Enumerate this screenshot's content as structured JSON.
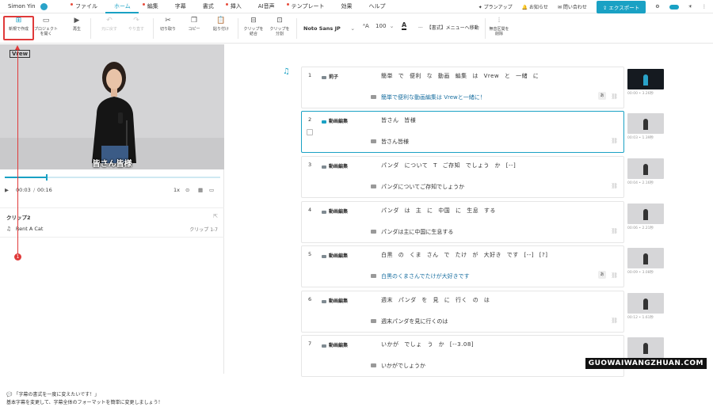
{
  "user": {
    "name": "Simon Yin"
  },
  "menu": [
    {
      "label": "ファイル",
      "dot": true
    },
    {
      "label": "ホーム",
      "dot": false,
      "active": true
    },
    {
      "label": "編集",
      "dot": true
    },
    {
      "label": "字幕",
      "dot": false
    },
    {
      "label": "書式",
      "dot": false
    },
    {
      "label": "挿入",
      "dot": true
    },
    {
      "label": "AI音声",
      "dot": false
    },
    {
      "label": "テンプレート",
      "dot": true
    },
    {
      "label": "効果",
      "dot": false
    },
    {
      "label": "ヘルプ",
      "dot": false
    }
  ],
  "top_right": {
    "plan": "プランアップ",
    "notice": "お知らせ",
    "contact": "問い合わせ",
    "export": "エクスポート"
  },
  "toolbar": {
    "new_project": "新規で作成",
    "open_project": [
      "プロジェクト",
      "を開く"
    ],
    "play": "再生",
    "undo": "元に戻す",
    "redo": "やり直す",
    "cut": "切り取り",
    "copy": "コピー",
    "paste": "貼り付け",
    "merge": [
      "クリップを",
      "結合"
    ],
    "split": [
      "クリップを",
      "分割"
    ],
    "font": "Noto Sans JP",
    "font_size": "100",
    "format_hint": "【書式】メニューへ移動",
    "silence": [
      "無音区間を",
      "削除"
    ]
  },
  "preview": {
    "logo": "Vrew",
    "subtitle": "皆さん皆様"
  },
  "player": {
    "current": "00:03",
    "total": "00:16",
    "speed": "1x"
  },
  "clip_panel": {
    "title": "クリップ2",
    "music": "Rent A Cat",
    "count": "クリップ 1-7"
  },
  "annotation": {
    "badge": "1"
  },
  "tip": {
    "title": "「字幕の書式を一度に変えたいです！」",
    "body": "基本字幕を変更して、字幕全体のフォーマットを簡単に変更しましょう！"
  },
  "clips": [
    {
      "num": "1",
      "speaker": "莉子",
      "words": "簡単 で 便利 な 動画 編集 は Vrew と 一緒 に",
      "subtitle": "簡単で便利な動画編集は Vrewと一緒に！",
      "blue": true,
      "aa": "あ",
      "thumb_label": "00:00 • 3.26秒",
      "dark": true
    },
    {
      "num": "2",
      "speaker": "動画編集",
      "words": "皆さん 皆様",
      "subtitle": "皆さん皆様",
      "blue": false,
      "aa": "",
      "thumb_label": "00:03 • 1.39秒",
      "dark": false,
      "selected": true
    },
    {
      "num": "3",
      "speaker": "動画編集",
      "words": "パンダ について T ご存知 でしょう か [--]",
      "subtitle": "パンダについてご存知でしょうか",
      "blue": false,
      "aa": "",
      "thumb_label": "00:04 • 2.16秒",
      "dark": false
    },
    {
      "num": "4",
      "speaker": "動画編集",
      "words": "パンダ は 主 に 中国 に 生息 する",
      "subtitle": "パンダは主に中国に生息する",
      "blue": false,
      "aa": "",
      "thumb_label": "00:06 • 2.21秒",
      "dark": false
    },
    {
      "num": "5",
      "speaker": "動画編集",
      "words": "白黒 の くま さん で たけ が 大好き です [--] [?]",
      "subtitle": "白黒のくまさんでたけが大好きです",
      "blue": true,
      "aa": "あ",
      "thumb_label": "00:09 • 3.08秒",
      "dark": false
    },
    {
      "num": "6",
      "speaker": "動画編集",
      "words": "週末 パンダ を 見 に 行く の は",
      "subtitle": "週末パンダを見に行くのは",
      "blue": false,
      "aa": "",
      "thumb_label": "00:12 • 1.61秒",
      "dark": false
    },
    {
      "num": "7",
      "speaker": "動画編集",
      "words": "いかが でしょ う か [--3.08]",
      "subtitle": "いかがでしょうか",
      "blue": false,
      "aa": "",
      "thumb_label": "",
      "dark": false
    }
  ],
  "watermark": "GUOWAIWANGZHUAN.COM",
  "colors": {
    "accent": "#1aa1c4",
    "annotation": "#e03a3a"
  }
}
